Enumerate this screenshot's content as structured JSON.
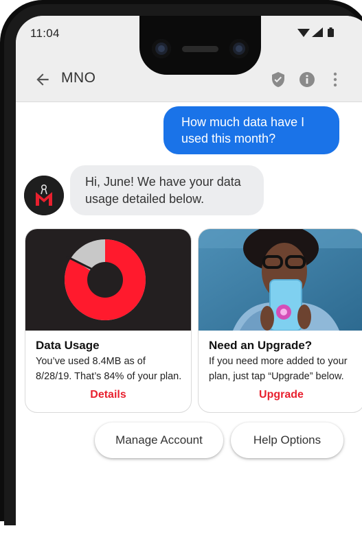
{
  "status_bar": {
    "time": "11:04"
  },
  "app_bar": {
    "title": "MNO"
  },
  "conversation": {
    "outgoing_message": "How much data have I used this month?",
    "incoming_message": "Hi, June! We have your data usage detailed below."
  },
  "cards": [
    {
      "title": "Data Usage",
      "description": "You’ve used 8.4MB as of 8/28/19. That’s 84% of your plan.",
      "action": "Details",
      "usage_percent": 84
    },
    {
      "title": "Need an Upgrade?",
      "description": "If you need more added to your plan, just tap “Upgrade” below.",
      "action": "Upgrade"
    }
  ],
  "suggestions": [
    "Manage Account",
    "Help Options"
  ],
  "colors": {
    "accent_blue": "#1a73e8",
    "brand_red": "#e8202e",
    "donut_red": "#ff1a2d",
    "donut_grey": "#c8c8c8"
  },
  "icons": [
    "back-arrow-icon",
    "shield-check-icon",
    "info-icon",
    "more-vert-icon",
    "wifi-icon",
    "signal-icon",
    "battery-icon"
  ]
}
